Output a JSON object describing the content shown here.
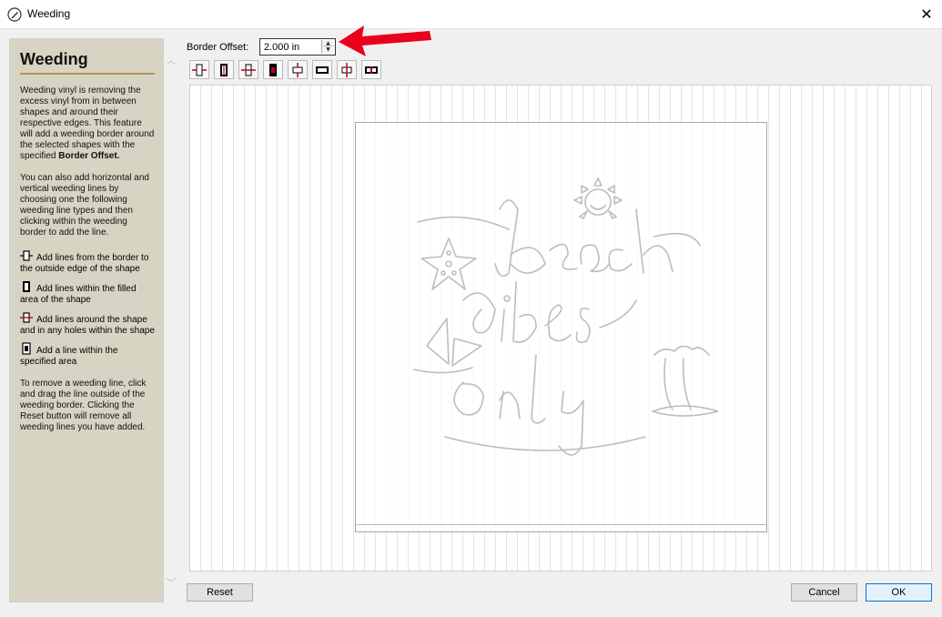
{
  "window": {
    "title": "Weeding",
    "close_glyph": "✕"
  },
  "help": {
    "heading": "Weeding",
    "intro_1": "Weeding vinyl is removing the excess vinyl from in between shapes and around their respective edges. This feature will add a weeding border around the selected shapes with the specified ",
    "intro_bold": "Border Offset.",
    "para_2": "You can also add horizontal and vertical weeding lines by choosing one the following weeding line types and then clicking within the weeding border to add the line.",
    "legend": [
      {
        "icon": "line-border-to-edge-icon",
        "text": "Add lines from the border to the outside edge of the shape"
      },
      {
        "icon": "line-within-filled-icon",
        "text": "Add lines within the filled area of the shape"
      },
      {
        "icon": "line-around-shape-icon",
        "text": "Add lines around the shape and in any holes within the shape"
      },
      {
        "icon": "line-within-area-icon",
        "text": "Add a line within the specified area"
      }
    ],
    "para_3": "To remove a weeding line, click and drag the line outside of the weeding border. Clicking the Reset button will remove all weeding lines you have added."
  },
  "border_offset": {
    "label": "Border Offset:",
    "value": "2.000 in"
  },
  "toolbar": {
    "tools": [
      "vertical-border-to-edge-icon",
      "vertical-within-filled-icon",
      "vertical-around-shape-icon",
      "vertical-within-area-icon",
      "horizontal-border-to-edge-icon",
      "horizontal-within-filled-icon",
      "horizontal-around-shape-icon",
      "horizontal-within-area-icon"
    ]
  },
  "buttons": {
    "reset": "Reset",
    "cancel": "Cancel",
    "ok": "OK"
  },
  "colors": {
    "accent_red": "#e8001c",
    "help_bg": "#d8d4c3",
    "help_rule": "#b59256"
  }
}
